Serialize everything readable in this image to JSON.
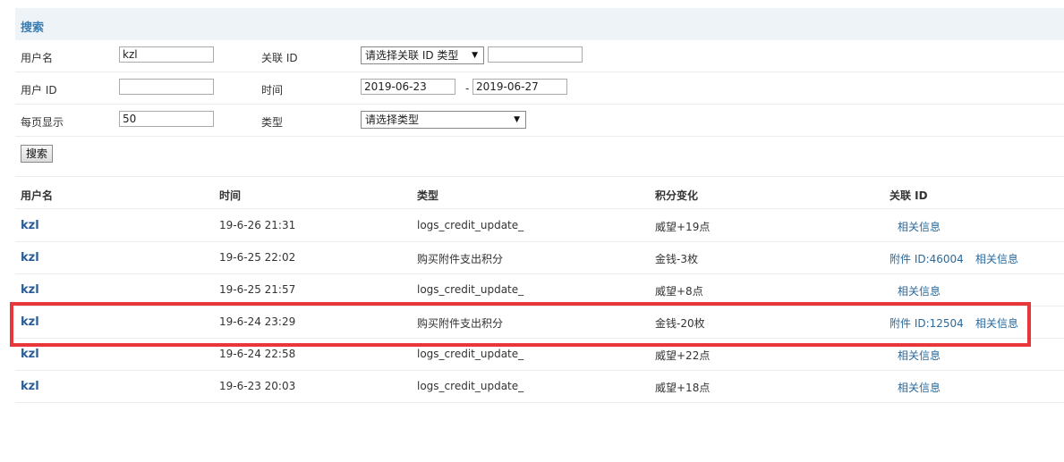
{
  "search": {
    "title": "搜索",
    "fields": {
      "username_label": "用户名",
      "username_value": "kzl",
      "related_id_label": "关联 ID",
      "related_id_type": "请选择关联 ID 类型",
      "related_id_value": "",
      "user_id_label": "用户 ID",
      "user_id_value": "",
      "time_label": "时间",
      "date_from": "2019-06-23",
      "date_sep": "-",
      "date_to": "2019-06-27",
      "per_page_label": "每页显示",
      "per_page_value": "50",
      "type_label": "类型",
      "type_value": "请选择类型"
    },
    "button": "搜索"
  },
  "table": {
    "headers": [
      "用户名",
      "时间",
      "类型",
      "积分变化",
      "关联 ID"
    ],
    "rows": [
      {
        "user": "kzl",
        "time": "19-6-26 21:31",
        "type": "logs_credit_update_",
        "change": "威望+19点",
        "attach": "",
        "info": "相关信息"
      },
      {
        "user": "kzl",
        "time": "19-6-25 22:02",
        "type": "购买附件支出积分",
        "change": "金钱-3枚",
        "attach": "附件 ID:46004",
        "info": "相关信息"
      },
      {
        "user": "kzl",
        "time": "19-6-25 21:57",
        "type": "logs_credit_update_",
        "change": "威望+8点",
        "attach": "",
        "info": "相关信息"
      },
      {
        "user": "kzl",
        "time": "19-6-24 23:29",
        "type": "购买附件支出积分",
        "change": "金钱-20枚",
        "attach": "附件 ID:12504",
        "info": "相关信息"
      },
      {
        "user": "kzl",
        "time": "19-6-24 22:58",
        "type": "logs_credit_update_",
        "change": "威望+22点",
        "attach": "",
        "info": "相关信息"
      },
      {
        "user": "kzl",
        "time": "19-6-23 20:03",
        "type": "logs_credit_update_",
        "change": "威望+18点",
        "attach": "",
        "info": "相关信息"
      }
    ]
  },
  "colors": {
    "highlight": "#e8363b",
    "link": "#2a6a9c"
  }
}
